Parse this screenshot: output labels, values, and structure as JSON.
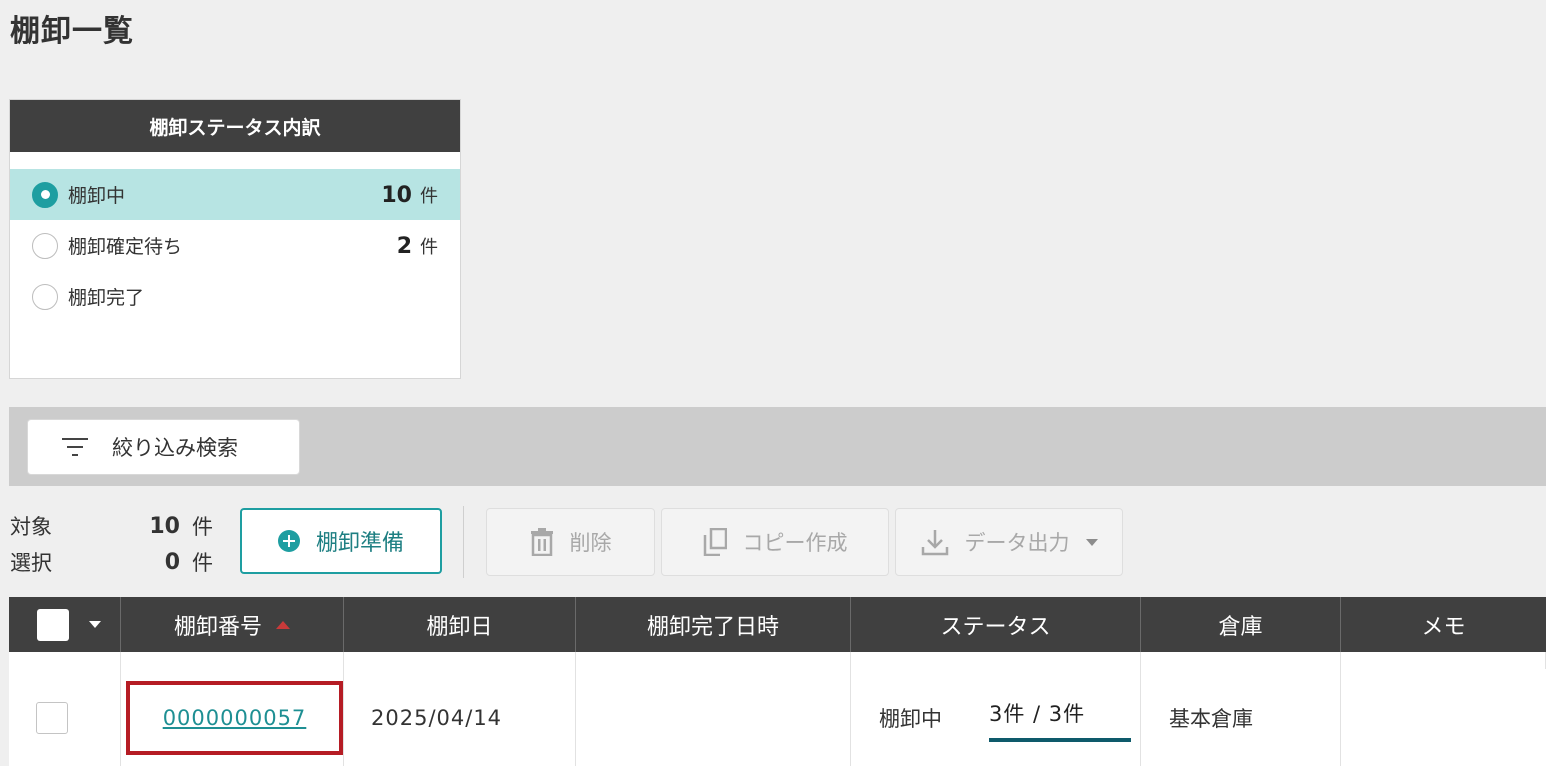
{
  "page": {
    "title": "棚卸一覧"
  },
  "status_panel": {
    "title": "棚卸ステータス内訳",
    "items": [
      {
        "label": "棚卸中",
        "count": "10",
        "unit": "件",
        "selected": true
      },
      {
        "label": "棚卸確定待ち",
        "count": "2",
        "unit": "件",
        "selected": false
      },
      {
        "label": "棚卸完了",
        "count": "",
        "unit": "",
        "selected": false
      }
    ]
  },
  "filter": {
    "button_label": "絞り込み検索"
  },
  "counts": {
    "target_label": "対象",
    "target_value": "10",
    "target_unit": "件",
    "selected_label": "選択",
    "selected_value": "0",
    "selected_unit": "件"
  },
  "toolbar": {
    "prepare_label": "棚卸準備",
    "delete_label": "削除",
    "copy_label": "コピー作成",
    "export_label": "データ出力"
  },
  "table": {
    "headers": [
      "棚卸番号",
      "棚卸日",
      "棚卸完了日時",
      "ステータス",
      "倉庫",
      "メモ"
    ],
    "sort_column": "棚卸番号",
    "rows": [
      {
        "number": "0000000057",
        "date": "2025/04/14",
        "completed_at": "",
        "status": "棚卸中",
        "progress_label": "3件 / 3件",
        "progress_fraction": 1.0,
        "warehouse": "基本倉庫",
        "memo": ""
      }
    ]
  },
  "colors": {
    "accent": "#1e9ea1",
    "header_bg": "#404040",
    "highlight_box": "#b51c24",
    "progress": "#0e5a6b"
  }
}
